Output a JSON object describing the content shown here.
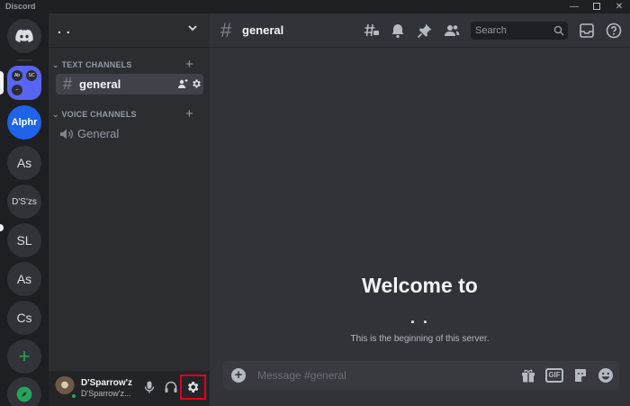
{
  "app": {
    "title": "Discord",
    "minimize": "—",
    "close": "✕"
  },
  "servers": {
    "active_labels": [
      "Ab",
      "SC",
      "–"
    ],
    "items": [
      {
        "label": "Alphr"
      },
      {
        "label": "As"
      },
      {
        "label": "D'S'zs"
      },
      {
        "label": "SL"
      },
      {
        "label": "As"
      },
      {
        "label": "Cs"
      }
    ],
    "add_label": "+"
  },
  "sidebar": {
    "server_name": ". .",
    "chevron": "⌄",
    "text_category": "TEXT CHANNELS",
    "voice_category": "VOICE CHANNELS",
    "category_add": "+",
    "text_channels": [
      {
        "name": "general"
      }
    ],
    "voice_channels": [
      {
        "name": "General"
      }
    ]
  },
  "user": {
    "name": "D'Sparrow'z",
    "tag": "D'Sparrow'z..."
  },
  "main": {
    "channel_name": "general",
    "search_placeholder": "Search",
    "welcome_title": "Welcome to",
    "welcome_server": ". .",
    "welcome_subtitle": "This is the beginning of this server.",
    "message_placeholder": "Message #general",
    "gif_label": "GIF"
  },
  "colors": {
    "accent": "#5865f2",
    "green": "#23a559",
    "highlight": "#e2001a"
  }
}
